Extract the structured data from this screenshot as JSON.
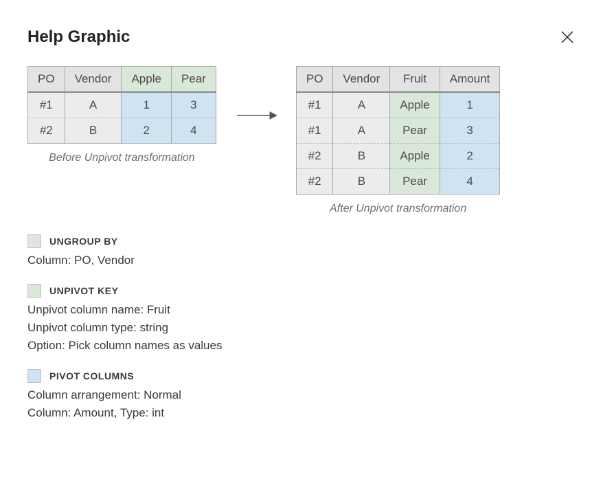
{
  "title": "Help Graphic",
  "before": {
    "headers": [
      "PO",
      "Vendor",
      "Apple",
      "Pear"
    ],
    "rows": [
      [
        "#1",
        "A",
        "1",
        "3"
      ],
      [
        "#2",
        "B",
        "2",
        "4"
      ]
    ],
    "caption": "Before Unpivot transformation"
  },
  "after": {
    "headers": [
      "PO",
      "Vendor",
      "Fruit",
      "Amount"
    ],
    "rows": [
      [
        "#1",
        "A",
        "Apple",
        "1"
      ],
      [
        "#1",
        "A",
        "Pear",
        "3"
      ],
      [
        "#2",
        "B",
        "Apple",
        "2"
      ],
      [
        "#2",
        "B",
        "Pear",
        "4"
      ]
    ],
    "caption": "After Unpivot transformation"
  },
  "legend": {
    "ungroup": {
      "label": "UNGROUP BY",
      "lines": [
        "Column: PO, Vendor"
      ]
    },
    "unpivot": {
      "label": "UNPIVOT KEY",
      "lines": [
        "Unpivot column name: Fruit",
        "Unpivot column type: string",
        "Option: Pick column names as values"
      ]
    },
    "pivot": {
      "label": "PIVOT COLUMNS",
      "lines": [
        "Column arrangement: Normal",
        "Column: Amount, Type: int"
      ]
    }
  }
}
